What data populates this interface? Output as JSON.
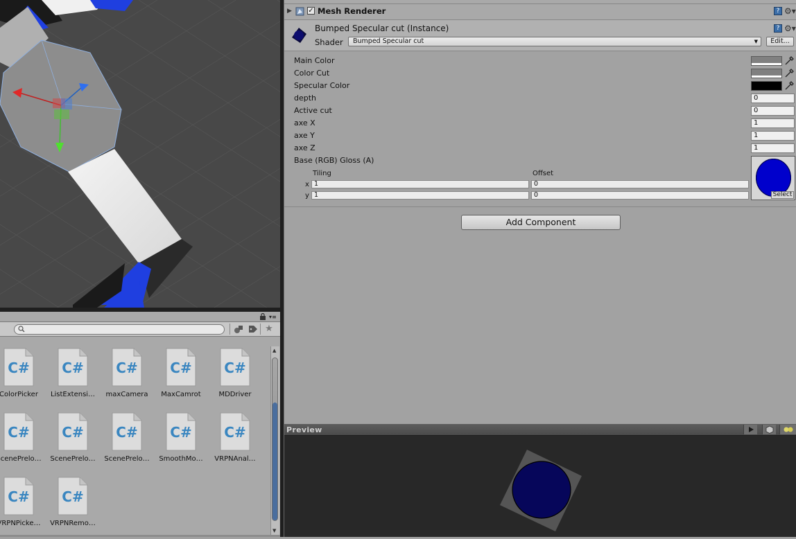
{
  "project": {
    "search_placeholder": "",
    "assets": [
      {
        "name": "ColorPicker",
        "icon": "csharp-script-icon"
      },
      {
        "name": "ListExtensi…",
        "icon": "csharp-script-icon"
      },
      {
        "name": "maxCamera",
        "icon": "csharp-script-icon"
      },
      {
        "name": "MaxCamrot",
        "icon": "csharp-script-icon"
      },
      {
        "name": "MDDriver",
        "icon": "csharp-script-icon"
      },
      {
        "name": "ScenePrelo…",
        "icon": "csharp-script-icon"
      },
      {
        "name": "ScenePrelo…",
        "icon": "csharp-script-icon"
      },
      {
        "name": "ScenePrelo…",
        "icon": "csharp-script-icon"
      },
      {
        "name": "SmoothMo…",
        "icon": "csharp-script-icon"
      },
      {
        "name": "VRPNAnal…",
        "icon": "csharp-script-icon"
      },
      {
        "name": "VRPNPicke…",
        "icon": "csharp-script-icon"
      },
      {
        "name": "VRPNRemo…",
        "icon": "csharp-script-icon"
      }
    ],
    "icon_glyph": "C#"
  },
  "inspector": {
    "mesh_renderer": {
      "title": "Mesh Renderer",
      "enabled_mark": "✓"
    },
    "material": {
      "title": "Bumped Specular cut (Instance)",
      "shader_label": "Shader",
      "shader_value": "Bumped Specular cut",
      "edit_label": "Edit...",
      "properties": {
        "main_color": {
          "label": "Main Color",
          "color": "#808080"
        },
        "color_cut": {
          "label": "Color Cut",
          "color": "#808080"
        },
        "specular_color": {
          "label": "Specular Color",
          "color": "#000000"
        },
        "depth": {
          "label": "depth",
          "value": "0"
        },
        "active_cut": {
          "label": "Active cut",
          "value": "0"
        },
        "axe_x": {
          "label": "axe X",
          "value": "1"
        },
        "axe_y": {
          "label": "axe Y",
          "value": "1"
        },
        "axe_z": {
          "label": "axe Z",
          "value": "1"
        }
      },
      "texture": {
        "label": "Base (RGB) Gloss (A)",
        "tiling_label": "Tiling",
        "offset_label": "Offset",
        "x_label": "x",
        "y_label": "y",
        "tiling_x": "1",
        "tiling_y": "1",
        "offset_x": "0",
        "offset_y": "0",
        "select_label": "Select",
        "color": "#0000cc"
      }
    },
    "add_component_label": "Add Component"
  },
  "preview": {
    "title": "Preview",
    "sphere_color": "#06065a"
  },
  "colors": {
    "accent_blue": "#1f3fe0",
    "selection_blue": "#4a6e9e"
  }
}
